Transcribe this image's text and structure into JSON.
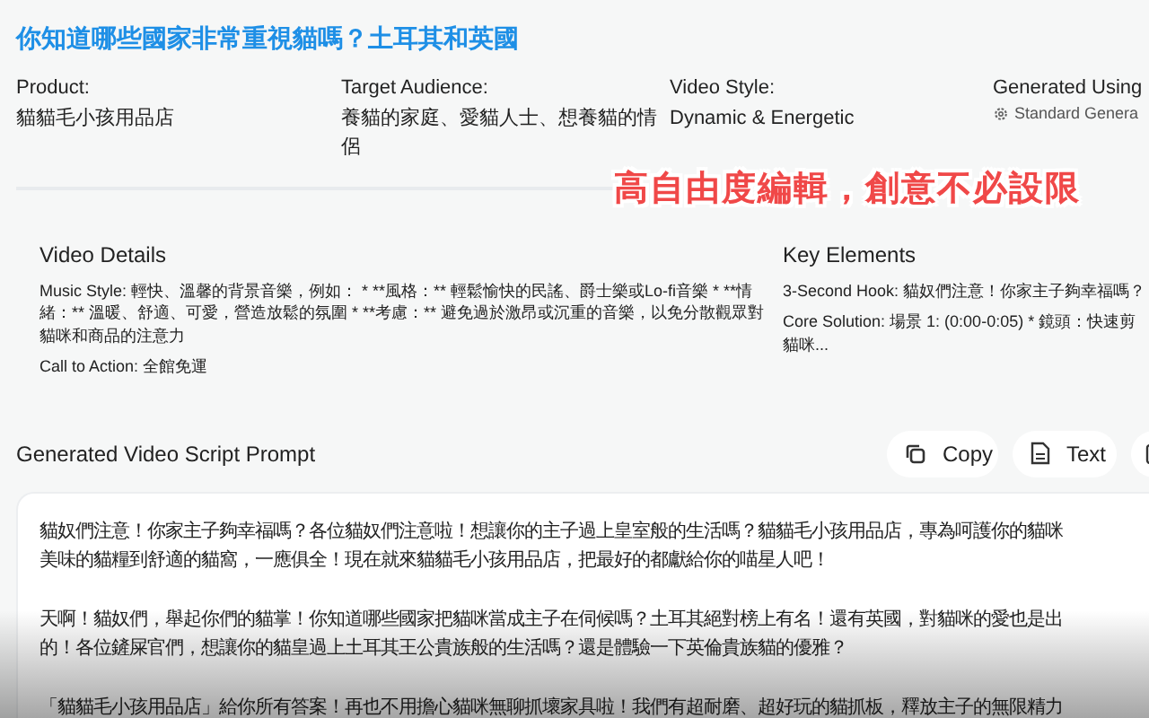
{
  "title": "你知道哪些國家非常重視貓嗎？土耳其和英國",
  "meta": [
    {
      "label": "Product:",
      "value": "貓貓毛小孩用品店",
      "kind": "text"
    },
    {
      "label": "Target Audience:",
      "value": "養貓的家庭、愛貓人士、想養貓的情侶",
      "kind": "text"
    },
    {
      "label": "Video Style:",
      "value": "Dynamic & Energetic",
      "kind": "text"
    },
    {
      "label": "Generated Using",
      "value": "Standard Genera",
      "kind": "model"
    }
  ],
  "caption": "高自由度編輯，創意不必設限",
  "video_details": {
    "heading": "Video Details",
    "items": [
      {
        "label": "Music Style:",
        "lines": [
          "輕快、溫馨的背景音樂，例如： * **風格：** 輕鬆愉快的民謠、爵士樂或Lo-fi音樂 * **情緒：** 溫暖、舒適、可愛，營造放鬆的氛圍 * **考慮：** 避免過於激昂或沉重的音樂，以免分散觀眾對貓咪和商品的注意力"
        ]
      },
      {
        "label": "Call to Action:",
        "lines": [
          "全館免運"
        ]
      }
    ]
  },
  "key_elements": {
    "heading": "Key Elements",
    "items": [
      {
        "label": "3-Second Hook:",
        "lines": [
          "貓奴們注意！你家主子夠幸福嗎？"
        ]
      },
      {
        "label": "Core Solution:",
        "lines": [
          "場景 1: (0:00-0:05) * 鏡頭：快速剪",
          "貓咪..."
        ]
      }
    ]
  },
  "prompt": {
    "heading": "Generated Video Script Prompt",
    "buttons": [
      {
        "label": "Copy",
        "kind": "copy"
      },
      {
        "label": "Text",
        "kind": "text"
      },
      {
        "kind": "image"
      }
    ],
    "paragraphs": [
      [
        "貓奴們注意！你家主子夠幸福嗎？各位貓奴們注意啦！想讓你的主子過上皇室般的生活嗎？貓貓毛小孩用品店，專為呵護你的貓咪",
        "美味的貓糧到舒適的貓窩，一應俱全！現在就來貓貓毛小孩用品店，把最好的都獻給你的喵星人吧！"
      ],
      [
        "天啊！貓奴們，舉起你們的貓掌！你知道哪些國家把貓咪當成主子在伺候嗎？土耳其絕對榜上有名！還有英國，對貓咪的愛也是出",
        "的！各位鏟屎官們，想讓你的貓皇過上土耳其王公貴族般的生活嗎？還是體驗一下英倫貴族貓的優雅？"
      ],
      [
        "「貓貓毛小孩用品店」給你所有答案！再也不用擔心貓咪無聊抓壞家具啦！我們有超耐磨、超好玩的貓抓板，釋放主子的無限精力"
      ]
    ]
  }
}
